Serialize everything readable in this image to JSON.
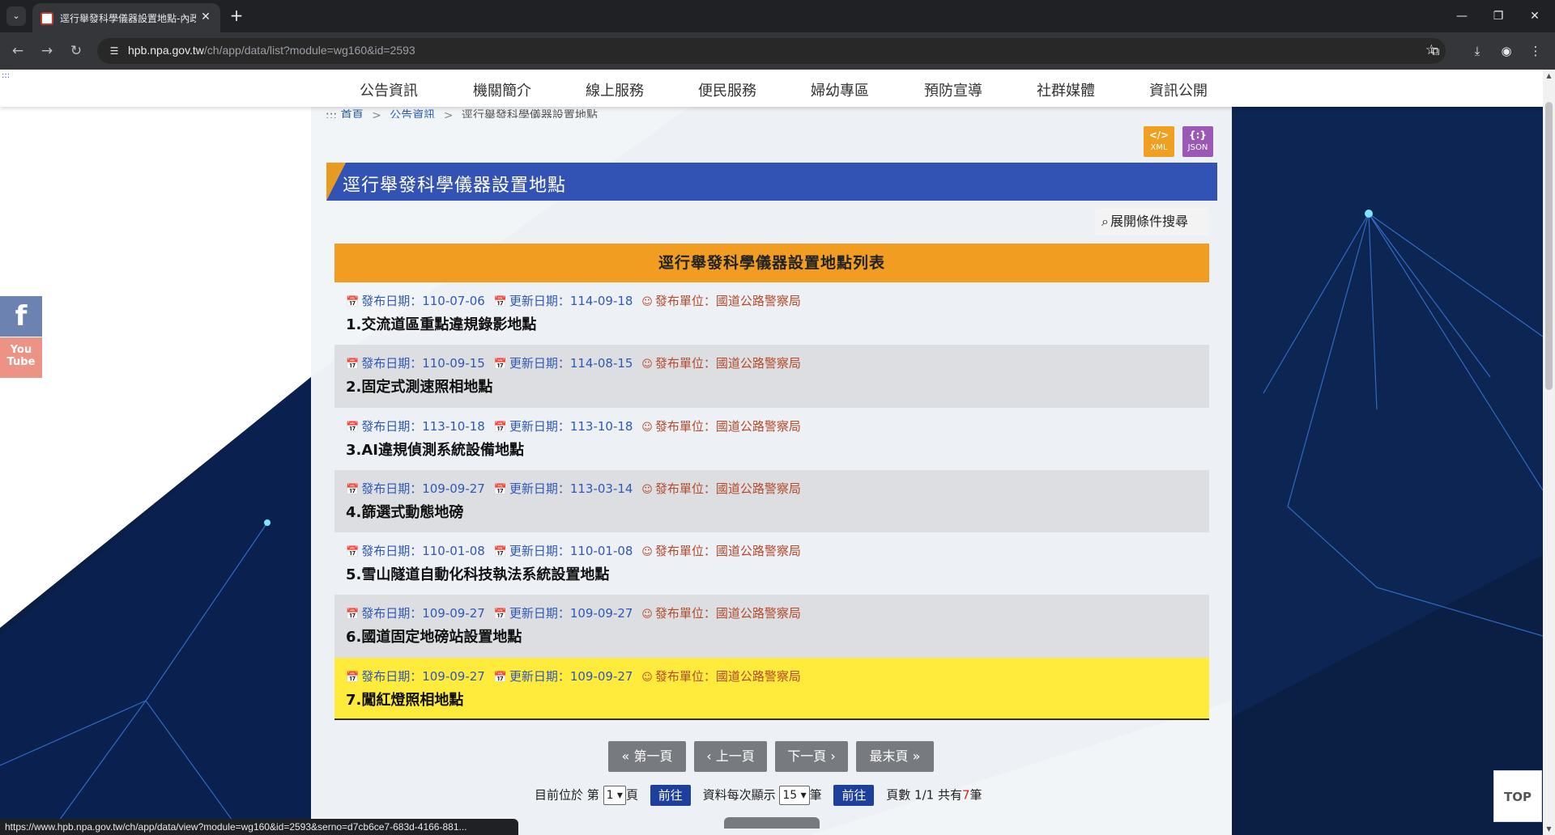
{
  "browser": {
    "tab_title": "逕行舉發科學儀器設置地點-內政部警政署",
    "url_host": "hpb.npa.gov.tw",
    "url_path": "/ch/app/data/list?module=wg160&id=2593",
    "status_url": "https://www.hpb.npa.gov.tw/ch/app/data/view?module=wg160&id=2593&serno=d7cb6ce7-683d-4166-881..."
  },
  "header": {
    "menu": [
      "公告資訊",
      "機關簡介",
      "線上服務",
      "便民服務",
      "婦幼專區",
      "預防宣導",
      "社群媒體",
      "資訊公開"
    ]
  },
  "breadcrumb": {
    "home": "首頁",
    "section": "公告資訊",
    "current": "逕行舉發科學儀器設置地點"
  },
  "formats": {
    "xml": "XML",
    "json": "JSON"
  },
  "page": {
    "title": "逕行舉發科學儀器設置地點",
    "search_toggle": "展開條件搜尋",
    "list_title": "逕行舉發科學儀器設置地點列表"
  },
  "labels": {
    "publish": "發布日期：",
    "update": "更新日期：",
    "unit": "發布單位："
  },
  "items": [
    {
      "pub": "110-07-06",
      "upd": "114-09-18",
      "unit": "國道公路警察局",
      "title": "1.交流道區重點違規錄影地點"
    },
    {
      "pub": "110-09-15",
      "upd": "114-08-15",
      "unit": "國道公路警察局",
      "title": "2.固定式測速照相地點"
    },
    {
      "pub": "113-10-18",
      "upd": "113-10-18",
      "unit": "國道公路警察局",
      "title": "3.AI違規偵測系統設備地點"
    },
    {
      "pub": "109-09-27",
      "upd": "113-03-14",
      "unit": "國道公路警察局",
      "title": "4.篩選式動態地磅"
    },
    {
      "pub": "110-01-08",
      "upd": "110-01-08",
      "unit": "國道公路警察局",
      "title": "5.雪山隧道自動化科技執法系統設置地點"
    },
    {
      "pub": "109-09-27",
      "upd": "109-09-27",
      "unit": "國道公路警察局",
      "title": "6.國道固定地磅站設置地點"
    },
    {
      "pub": "109-09-27",
      "upd": "109-09-27",
      "unit": "國道公路警察局",
      "title": "7.闖紅燈照相地點"
    }
  ],
  "pager": {
    "first": "第一頁",
    "prev": "上一頁",
    "next": "下一頁",
    "last": "最末頁",
    "current_prefix": "目前位於 第",
    "page_value": "1",
    "page_suffix": "頁",
    "go": "前往",
    "per_page_label": "資料每次顯示",
    "per_page_value": "15",
    "per_page_suffix": "筆",
    "summary_prefix": "頁數 1/1 共有",
    "total": "7",
    "summary_suffix": "筆"
  },
  "social": {
    "facebook": "f",
    "youtube_top": "You",
    "youtube_bottom": "Tube"
  },
  "top_button": "TOP"
}
